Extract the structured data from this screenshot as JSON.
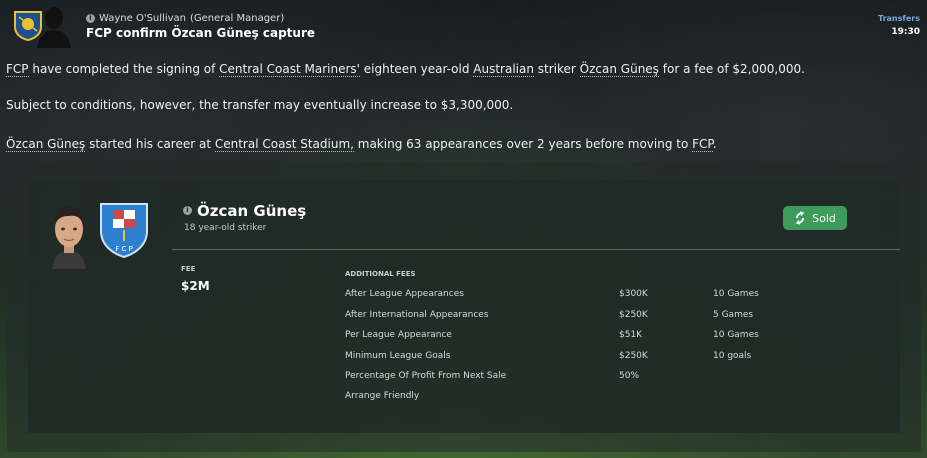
{
  "header": {
    "sender": "Wayne O'Sullivan",
    "sender_role": "(General Manager)",
    "subject": "FCP confirm Özcan Güneş capture",
    "category": "Transfers",
    "time": "19:30"
  },
  "body": {
    "p1": {
      "club": "FCP",
      "t1": " have completed the signing of ",
      "seller": "Central Coast Mariners'",
      "t2": " eighteen year-old ",
      "nationality": "Australian",
      "t3": " striker ",
      "player": "Özcan Güneş",
      "t4": " for a fee of $2,000,000."
    },
    "p2": "Subject to conditions, however, the transfer may eventually increase to $3,300,000.",
    "p3": {
      "player": "Özcan Güneş",
      "t1": " started his career at ",
      "stadium": "Central Coast Stadium,",
      "t2": " making 63 appearances over 2 years before moving to ",
      "club": "FCP",
      "t3": "."
    }
  },
  "card": {
    "player_name": "Özcan Güneş",
    "player_desc": "18 year-old striker",
    "status_button": "Sold",
    "fee_label": "FEE",
    "fee_value": "$2M",
    "additional_label": "ADDITIONAL FEES",
    "additional_fees": [
      {
        "condition": "After League Appearances",
        "amount": "$300K",
        "requirement": "10 Games"
      },
      {
        "condition": "After International Appearances",
        "amount": "$250K",
        "requirement": "5 Games"
      },
      {
        "condition": "Per League Appearance",
        "amount": "$51K",
        "requirement": "10 Games"
      },
      {
        "condition": "Minimum League Goals",
        "amount": "$250K",
        "requirement": "10 goals"
      },
      {
        "condition": "Percentage Of Profit From Next Sale",
        "amount": "50%",
        "requirement": ""
      },
      {
        "condition": "Arrange Friendly",
        "amount": "",
        "requirement": ""
      }
    ],
    "crest_letters": "F C P"
  },
  "colors": {
    "accent_link": "#7ea4d8",
    "sold_green": "#3f9b5b",
    "crest_blue": "#2f7fd0"
  },
  "icons": {
    "info": "info-icon",
    "sold": "transfer-sold-icon"
  }
}
